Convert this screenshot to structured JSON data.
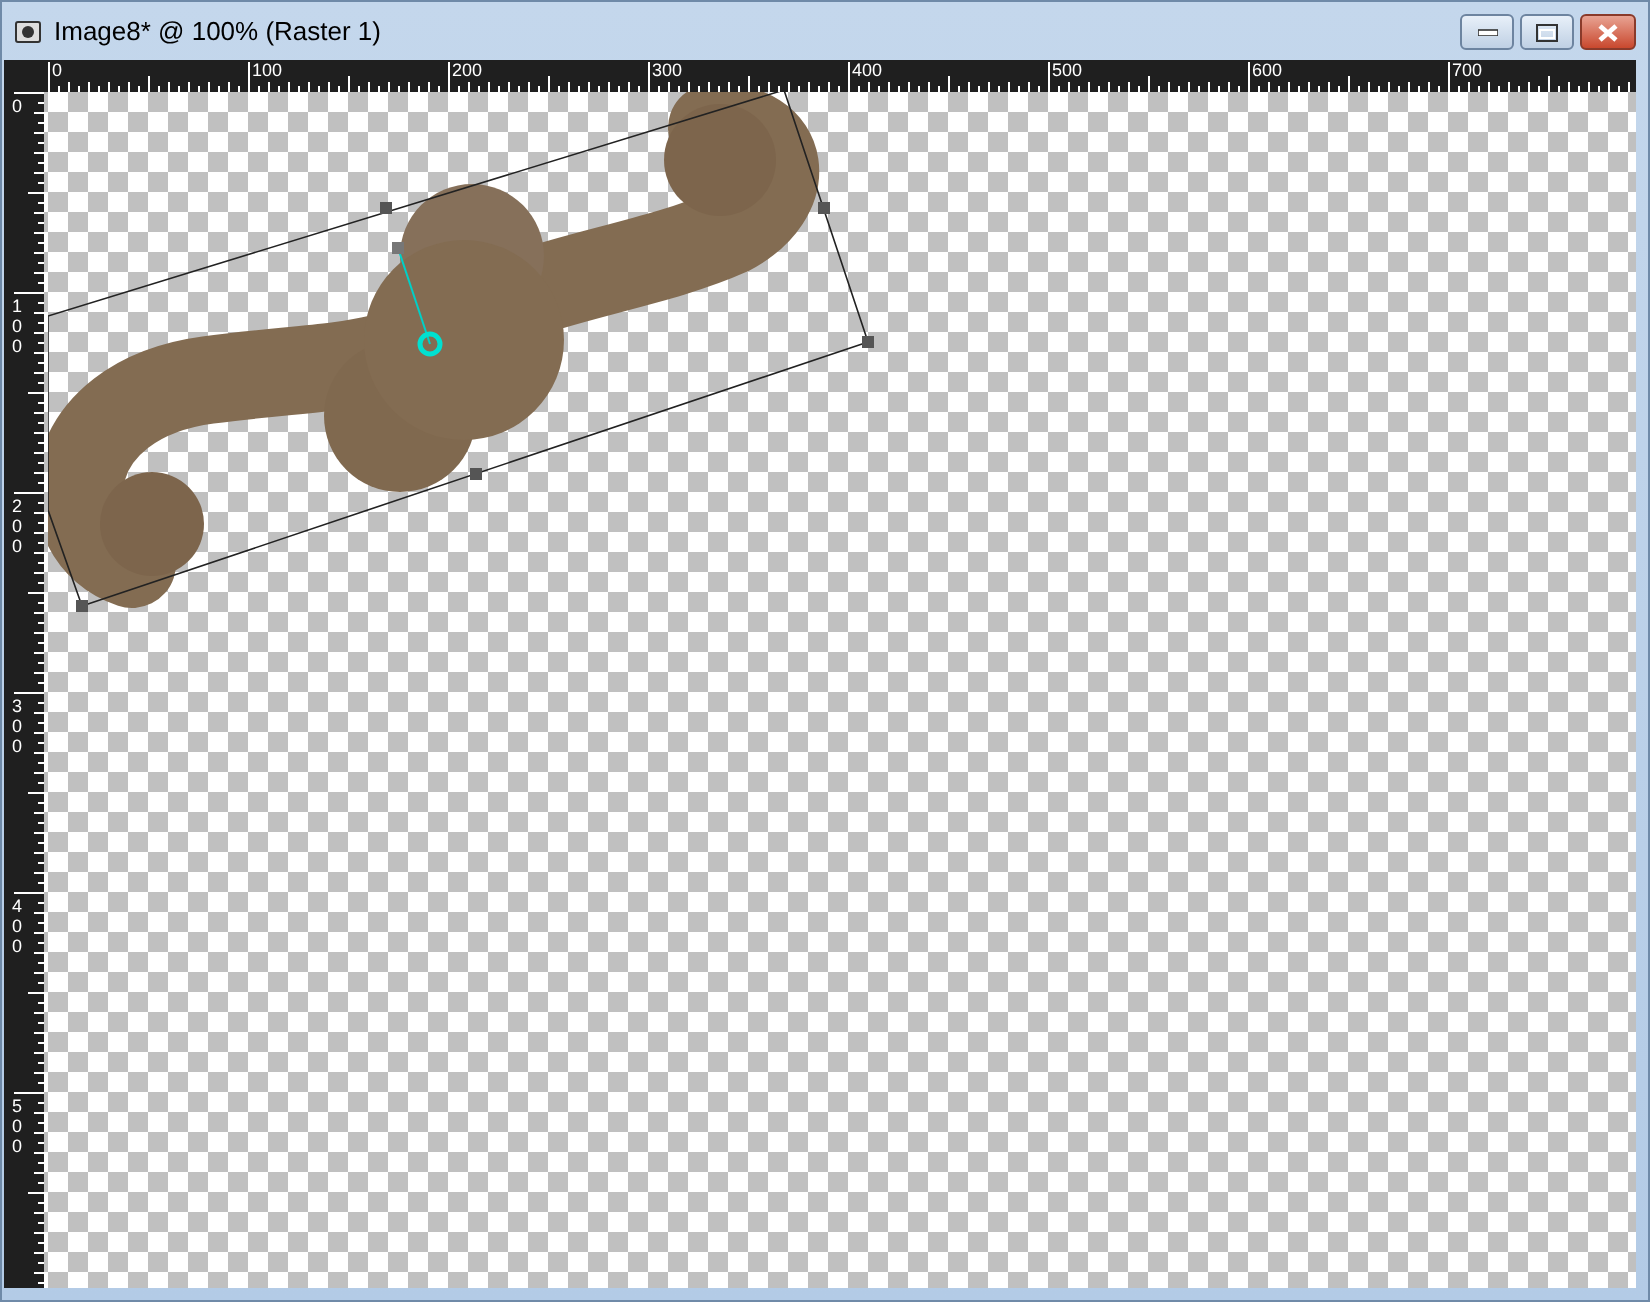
{
  "window": {
    "title": "Image8* @ 100% (Raster 1)"
  },
  "rulers": {
    "horizontal": [
      "0",
      "100",
      "200",
      "300",
      "400",
      "500",
      "600",
      "700"
    ],
    "vertical": [
      "0",
      "100",
      "200",
      "300",
      "400",
      "500"
    ]
  }
}
